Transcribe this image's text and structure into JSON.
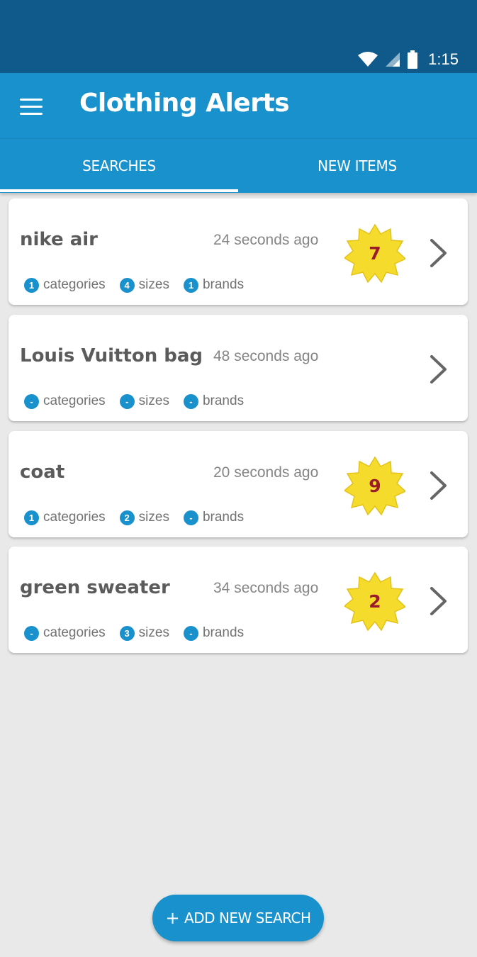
{
  "status_bar": {
    "time": "1:15"
  },
  "app_bar": {
    "title": "Clothing Alerts"
  },
  "tabs": [
    {
      "label": "SEARCHES",
      "active": true
    },
    {
      "label": "NEW ITEMS",
      "active": false
    }
  ],
  "searches": [
    {
      "title": "nike air",
      "time": "24 seconds ago",
      "new_count": "7",
      "categories": "1",
      "sizes": "4",
      "brands": "1",
      "categories_label": "categories",
      "sizes_label": "sizes",
      "brands_label": "brands"
    },
    {
      "title": "Louis Vuitton bag",
      "time": "48 seconds ago",
      "new_count": "",
      "categories": "-",
      "sizes": "-",
      "brands": "-",
      "categories_label": "categories",
      "sizes_label": "sizes",
      "brands_label": "brands"
    },
    {
      "title": "coat",
      "time": "20 seconds ago",
      "new_count": "9",
      "categories": "1",
      "sizes": "2",
      "brands": "-",
      "categories_label": "categories",
      "sizes_label": "sizes",
      "brands_label": "brands"
    },
    {
      "title": "green sweater",
      "time": "34 seconds ago",
      "new_count": "2",
      "categories": "-",
      "sizes": "3",
      "brands": "-",
      "categories_label": "categories",
      "sizes_label": "sizes",
      "brands_label": "brands"
    }
  ],
  "fab": {
    "plus": "+",
    "label": "ADD NEW SEARCH"
  },
  "colors": {
    "status_bar": "#0f5a8a",
    "primary": "#1891cd",
    "badge_star": "#f5dc2c",
    "star_count_text": "#9a1b2a",
    "background": "#e9e9e9"
  },
  "icons": {
    "menu": "menu-icon",
    "wifi": "wifi-icon",
    "signal": "signal-icon",
    "battery": "battery-icon",
    "chevron": "chevron-right-icon",
    "star": "star-badge-icon"
  }
}
